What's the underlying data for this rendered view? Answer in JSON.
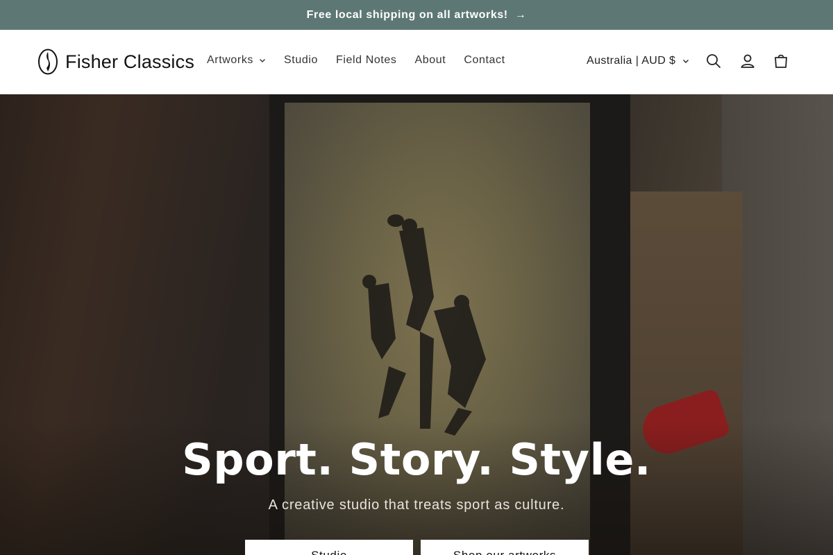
{
  "announcement": {
    "text": "Free local shipping on all artworks!",
    "arrow": "→"
  },
  "header": {
    "logo_text": "Fisher Classics",
    "nav": [
      {
        "label": "Artworks",
        "has_dropdown": true
      },
      {
        "label": "Studio"
      },
      {
        "label": "Field Notes"
      },
      {
        "label": "About"
      },
      {
        "label": "Contact"
      }
    ],
    "locale": "Australia | AUD $",
    "icons": [
      "search-icon",
      "account-icon",
      "cart-icon"
    ]
  },
  "hero": {
    "title": "Sport. Story. Style.",
    "subtitle": "A creative studio that treats sport as culture.",
    "buttons": [
      {
        "label": "Studio"
      },
      {
        "label": "Shop our artworks"
      }
    ]
  },
  "colors": {
    "announcement_bg": "#5d7774",
    "header_bg": "#ffffff",
    "button_bg": "#ffffff"
  }
}
